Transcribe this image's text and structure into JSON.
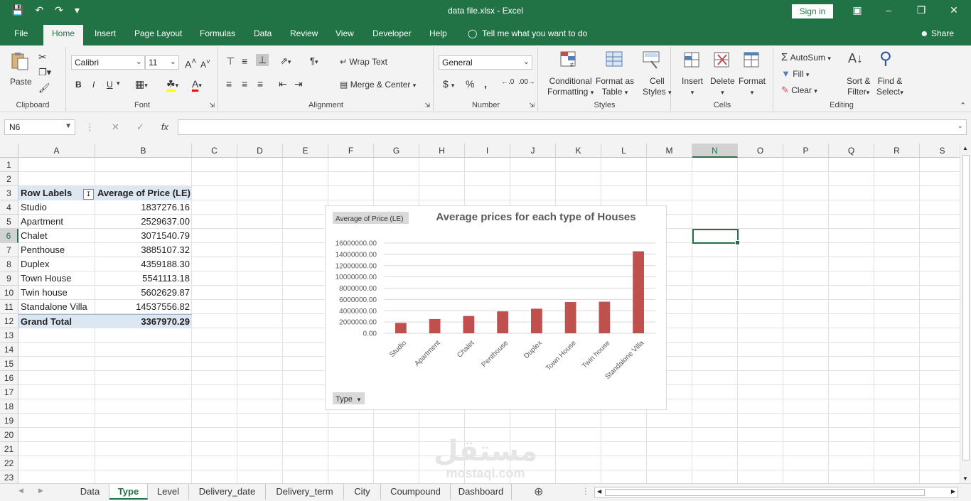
{
  "app": {
    "title": "data file.xlsx  -  Excel",
    "sign_in": "Sign in",
    "tell_me": "Tell me what you want to do",
    "share": "Share"
  },
  "menu": [
    "File",
    "Home",
    "Insert",
    "Page Layout",
    "Formulas",
    "Data",
    "Review",
    "View",
    "Developer",
    "Help"
  ],
  "ribbon": {
    "clipboard": {
      "paste": "Paste",
      "label": "Clipboard"
    },
    "font": {
      "name": "Calibri",
      "size": "11",
      "bold": "B",
      "italic": "I",
      "underline": "U",
      "label": "Font"
    },
    "alignment": {
      "wrap": "Wrap Text",
      "merge": "Merge & Center",
      "label": "Alignment"
    },
    "number": {
      "format": "General",
      "currency": "$",
      "percent": "%",
      "comma": ",",
      "label": "Number"
    },
    "styles": {
      "conditional": "Conditional",
      "formatting": "Formatting",
      "format_as": "Format as",
      "table": "Table",
      "cell": "Cell",
      "cell_styles": "Styles",
      "label": "Styles"
    },
    "cells": {
      "insert": "Insert",
      "delete": "Delete",
      "format": "Format",
      "label": "Cells"
    },
    "editing": {
      "autosum": "AutoSum",
      "fill": "Fill",
      "clear": "Clear",
      "sort": "Sort &",
      "filter": "Filter",
      "find": "Find &",
      "select": "Select",
      "label": "Editing"
    }
  },
  "formula_bar": {
    "name_box": "N6",
    "fx": "fx",
    "content": ""
  },
  "columns": [
    "A",
    "B",
    "C",
    "D",
    "E",
    "F",
    "G",
    "H",
    "I",
    "J",
    "K",
    "L",
    "M",
    "N",
    "O",
    "P",
    "Q",
    "R",
    "S"
  ],
  "rows": [
    "1",
    "2",
    "3",
    "4",
    "5",
    "6",
    "7",
    "8",
    "9",
    "10",
    "11",
    "12",
    "13",
    "14",
    "15",
    "16",
    "17",
    "18",
    "19",
    "20",
    "21",
    "22",
    "23"
  ],
  "pivot": {
    "header_label": "Row Labels",
    "header_value": "Average of Price (LE)",
    "items": [
      {
        "label": "Studio",
        "value": "1837276.16"
      },
      {
        "label": "Apartment",
        "value": "2529637.00"
      },
      {
        "label": "Chalet",
        "value": "3071540.79"
      },
      {
        "label": "Penthouse",
        "value": "3885107.32"
      },
      {
        "label": "Duplex",
        "value": "4359188.30"
      },
      {
        "label": "Town House",
        "value": "5541113.18"
      },
      {
        "label": "Twin house",
        "value": "5602629.87"
      },
      {
        "label": "Standalone Villa",
        "value": "14537556.82"
      }
    ],
    "total_label": "Grand Total",
    "total_value": "3367970.29"
  },
  "chart_data": {
    "type": "bar",
    "title": "Average prices for each type of Houses",
    "field_button": "Average of Price (LE)",
    "axis_field_button": "Type",
    "categories": [
      "Studio",
      "Apartment",
      "Chalet",
      "Penthouse",
      "Duplex",
      "Town House",
      "Twin house",
      "Standalone Villa"
    ],
    "values": [
      1837276.16,
      2529637.0,
      3071540.79,
      3885107.32,
      4359188.3,
      5541113.18,
      5602629.87,
      14537556.82
    ],
    "ylim": [
      0,
      16000000
    ],
    "yticks": [
      "0.00",
      "2000000.00",
      "4000000.00",
      "6000000.00",
      "8000000.00",
      "10000000.00",
      "12000000.00",
      "14000000.00",
      "16000000.00"
    ],
    "bar_color": "#c0504d",
    "grid": true
  },
  "sheets": [
    "Data",
    "Type",
    "Level",
    "Delivery_date",
    "Delivery_term",
    "City",
    "Coumpound",
    "Dashboard"
  ],
  "active_sheet": "Type",
  "watermark": {
    "main": "مستقل",
    "sub": "mostaql.com"
  }
}
